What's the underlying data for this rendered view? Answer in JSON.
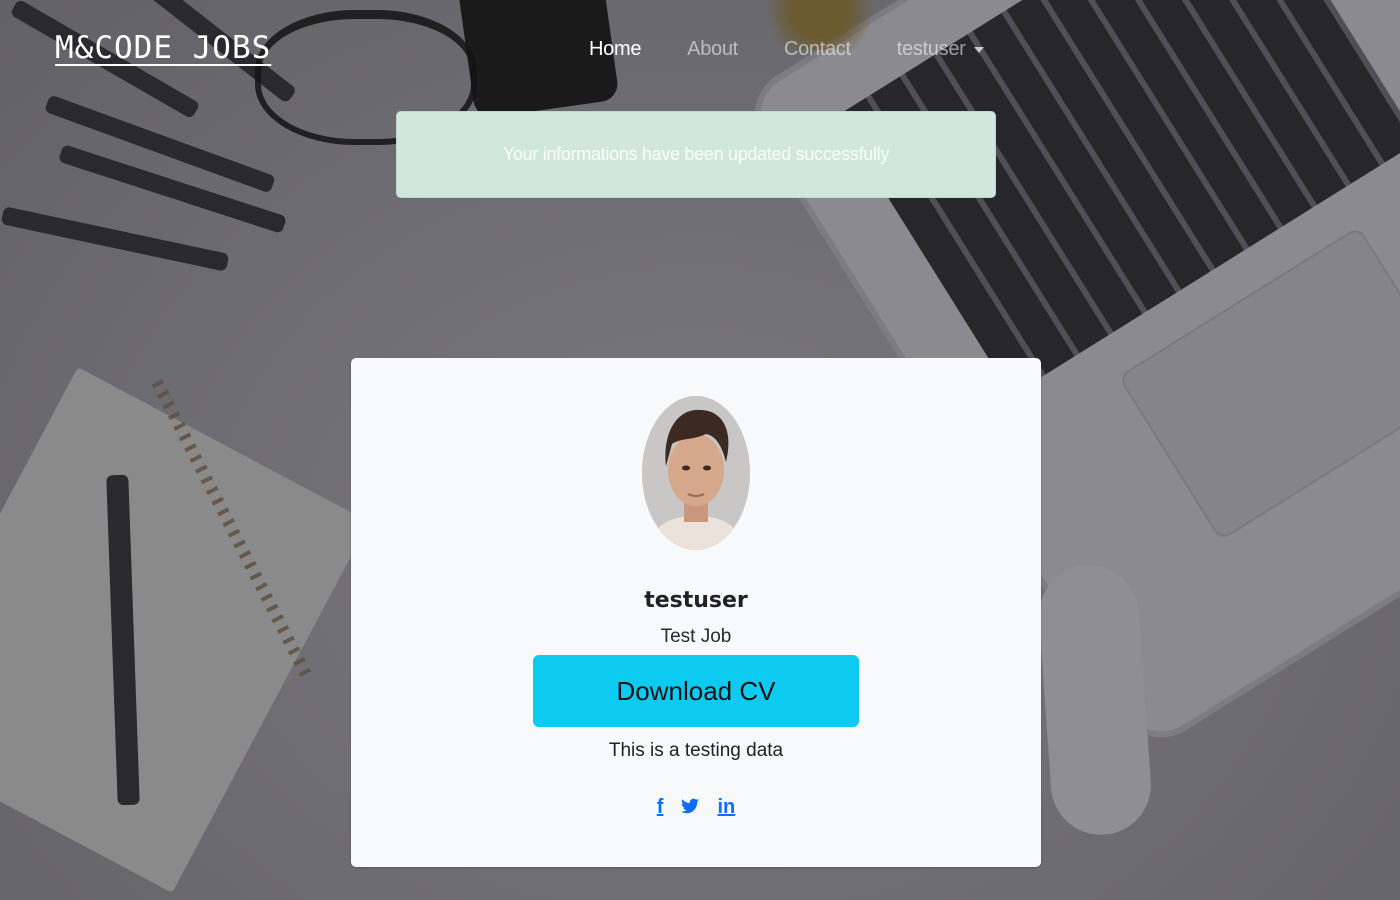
{
  "brand": "M&CODE_JOBS",
  "nav": {
    "home": "Home",
    "about": "About",
    "contact": "Contact",
    "user": "testuser"
  },
  "alert": {
    "message": "Your informations have been updated successfully"
  },
  "profile": {
    "username": "testuser",
    "job": "Test Job",
    "download_label": "Download CV",
    "description": "This is a testing data",
    "social": {
      "facebook": "f",
      "twitter": "twitter-icon",
      "linkedin": "in"
    }
  },
  "colors": {
    "alert_bg": "#d1e7dd",
    "button_bg": "#0dcaf0",
    "link": "#0d6efd",
    "card_bg": "#f8f9fb"
  }
}
